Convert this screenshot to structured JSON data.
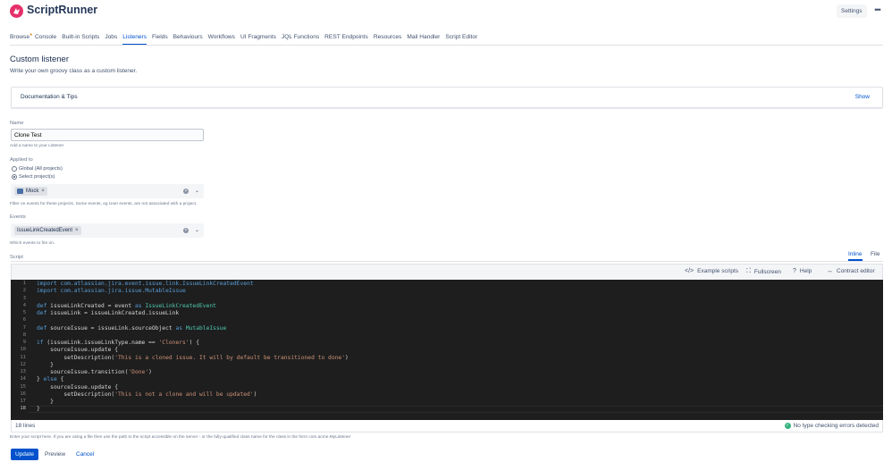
{
  "app": {
    "brand": "ScriptRunner",
    "settings_label": "Settings",
    "more_label": "•••"
  },
  "nav": {
    "items": [
      {
        "label": "Browse",
        "badge": "•"
      },
      {
        "label": "Console"
      },
      {
        "label": "Built-in Scripts"
      },
      {
        "label": "Jobs"
      },
      {
        "label": "Listeners",
        "active": true
      },
      {
        "label": "Fields"
      },
      {
        "label": "Behaviours"
      },
      {
        "label": "Workflows"
      },
      {
        "label": "UI Fragments"
      },
      {
        "label": "JQL Functions"
      },
      {
        "label": "REST Endpoints"
      },
      {
        "label": "Resources"
      },
      {
        "label": "Mail Handler"
      },
      {
        "label": "Script Editor"
      }
    ]
  },
  "page": {
    "title": "Custom listener",
    "subtitle": "Write your own groovy class as a custom listener."
  },
  "docs": {
    "title": "Documentation & Tips",
    "toggle": "Show"
  },
  "form": {
    "name": {
      "label": "Name",
      "value": "Clone Test",
      "help": "Add a name to your Listener"
    },
    "applied_to": {
      "label": "Applied to",
      "options": [
        {
          "label": "Global (All projects)",
          "checked": false
        },
        {
          "label": "Select project(s)",
          "checked": true
        }
      ],
      "selected_tag": "Mock",
      "help": "Filter on events for these projects. Some events, eg User events, are not associated with a project."
    },
    "events": {
      "label": "Events",
      "selected_tag": "IssueLinkCreatedEvent",
      "help": "Which events to fire on."
    },
    "script": {
      "label": "Script",
      "tabs": {
        "inline": "Inline",
        "file": "File"
      },
      "toolbar": {
        "examples": "Example scripts",
        "fullscreen": "Fullscreen",
        "help": "Help",
        "contract": "Contract editor"
      },
      "line_count": "18 lines",
      "status": "No type checking errors detected",
      "help": "Enter your script here. If you are using a file then use the path to the script accessible on the server - or the fully-qualified class name for the class in the form com.acme.MyListener"
    }
  },
  "code": {
    "lines": [
      "import com.atlassian.jira.event.issue.link.IssueLinkCreatedEvent",
      "import com.atlassian.jira.issue.MutableIssue",
      "",
      "def issueLinkCreated = event as IssueLinkCreatedEvent",
      "def issueLink = issueLinkCreated.issueLink",
      "",
      "def sourceIssue = issueLink.sourceObject as MutableIssue",
      "",
      "if (issueLink.issueLinkType.name == 'Cloners') {",
      "    sourceIssue.update {",
      "        setDescription('This is a cloned issue. It will by default be transitioned to done')",
      "    }",
      "    sourceIssue.transition('Done')",
      "} else {",
      "    sourceIssue.update {",
      "        setDescription('This is not a clone and will be updated')",
      "    }",
      "}"
    ]
  },
  "actions": {
    "update": "Update",
    "preview": "Preview",
    "cancel": "Cancel"
  },
  "colors": {
    "brand": "#e5306a",
    "primary": "#0052cc",
    "success": "#36b37e",
    "editor_bg": "#1e1e1e"
  }
}
